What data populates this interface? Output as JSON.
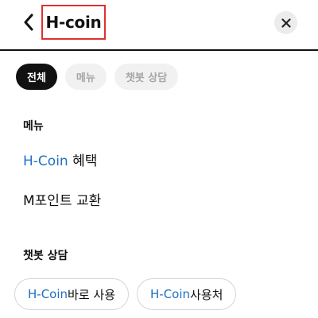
{
  "header": {
    "search_query": "H-coin"
  },
  "filters": [
    {
      "label": "전체",
      "active": true
    },
    {
      "label": "메뉴",
      "active": false
    },
    {
      "label": "챗봇 상담",
      "active": false
    }
  ],
  "menu_section": {
    "title": "메뉴",
    "items": [
      {
        "brand": "H-Coin",
        "rest": " 혜택"
      },
      {
        "brand": "",
        "rest": "M포인트 교환"
      }
    ]
  },
  "chatbot_section": {
    "title": "챗봇 상담",
    "chips": [
      {
        "brand": "H-Coin",
        "rest": " 바로 사용"
      },
      {
        "brand": "H-Coin",
        "rest": " 사용처"
      }
    ]
  },
  "colors": {
    "brand_blue": "#1f6fc4",
    "highlight_red": "#e0312f",
    "active_chip": "#111111"
  }
}
